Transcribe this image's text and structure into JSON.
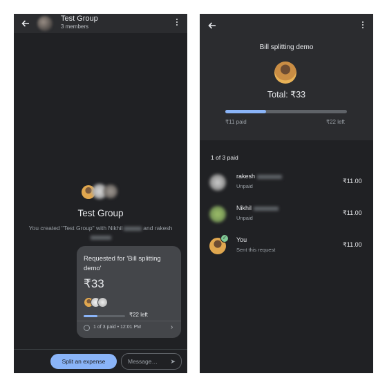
{
  "left": {
    "header": {
      "title": "Test Group",
      "subtitle": "3 members"
    },
    "group": {
      "title": "Test Group",
      "desc_prefix": "You created \"Test Group\" with Nikhil",
      "desc_and": "and rakesh"
    },
    "request_card": {
      "title": "Requested for 'Bill splitting demo'",
      "amount": "₹33",
      "left_text": "₹22 left",
      "status": "1 of 3 paid • 12:01 PM",
      "paid_fraction": 0.333
    },
    "bottom": {
      "split_button": "Split an expense",
      "message_placeholder": "Message…"
    }
  },
  "right": {
    "title": "Bill splitting demo",
    "total": "Total: ₹33",
    "progress_fraction": 0.333,
    "paid_label": "₹11 paid",
    "left_label": "₹22 left",
    "paid_count": "1 of 3 paid",
    "people": [
      {
        "name": "rakesh",
        "status": "Unpaid",
        "amount": "₹11.00"
      },
      {
        "name": "Nikhil",
        "status": "Unpaid",
        "amount": "₹11.00"
      },
      {
        "name": "You",
        "status": "Sent this request",
        "amount": "₹11.00"
      }
    ]
  },
  "colors": {
    "background": "#202124",
    "surface": "#2b2c2f",
    "card": "#44464a",
    "accent": "#8ab4f8",
    "paid_check": "#81c995"
  }
}
